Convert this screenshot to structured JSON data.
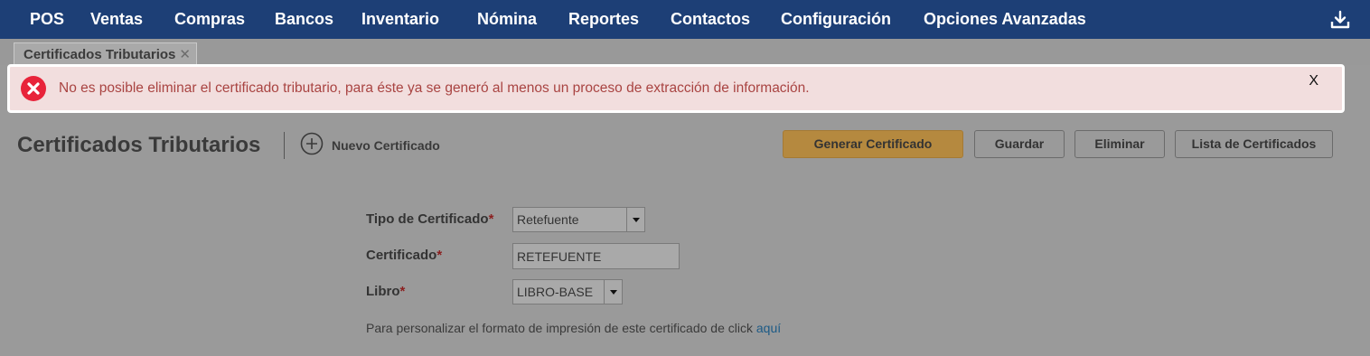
{
  "nav": {
    "items": [
      "POS",
      "Ventas",
      "Compras",
      "Bancos",
      "Inventario",
      "Nómina",
      "Reportes",
      "Contactos",
      "Configuración",
      "Opciones Avanzadas"
    ],
    "download_icon": "download-icon"
  },
  "tab": {
    "label": "Certificados Tributarios",
    "close": "✕"
  },
  "alert": {
    "icon": "error-circle-icon",
    "message": "No es posible eliminar el certificado tributario, para éste ya se generó al menos un proceso de extracción de información.",
    "close": "X"
  },
  "header": {
    "title": "Certificados Tributarios",
    "new_label": "Nuevo Certificado",
    "buttons": {
      "generate": "Generar Certificado",
      "save": "Guardar",
      "delete": "Eliminar",
      "list": "Lista de Certificados"
    }
  },
  "form": {
    "tipo": {
      "label": "Tipo de Certificado",
      "required": "*",
      "value": "Retefuente"
    },
    "certificado": {
      "label": "Certificado",
      "required": "*",
      "value": "RETEFUENTE"
    },
    "libro": {
      "label": "Libro",
      "required": "*",
      "value": "LIBRO-BASE"
    }
  },
  "help": {
    "text": "Para personalizar el formato de impresión de este certificado de click ",
    "link": "aquí"
  },
  "colors": {
    "nav_bg": "#1d3f76",
    "alert_bg": "#f2dede",
    "alert_text": "#a94442",
    "error_icon": "#e8233a",
    "primary_button": "#b5893f",
    "link": "#1b5a86"
  }
}
